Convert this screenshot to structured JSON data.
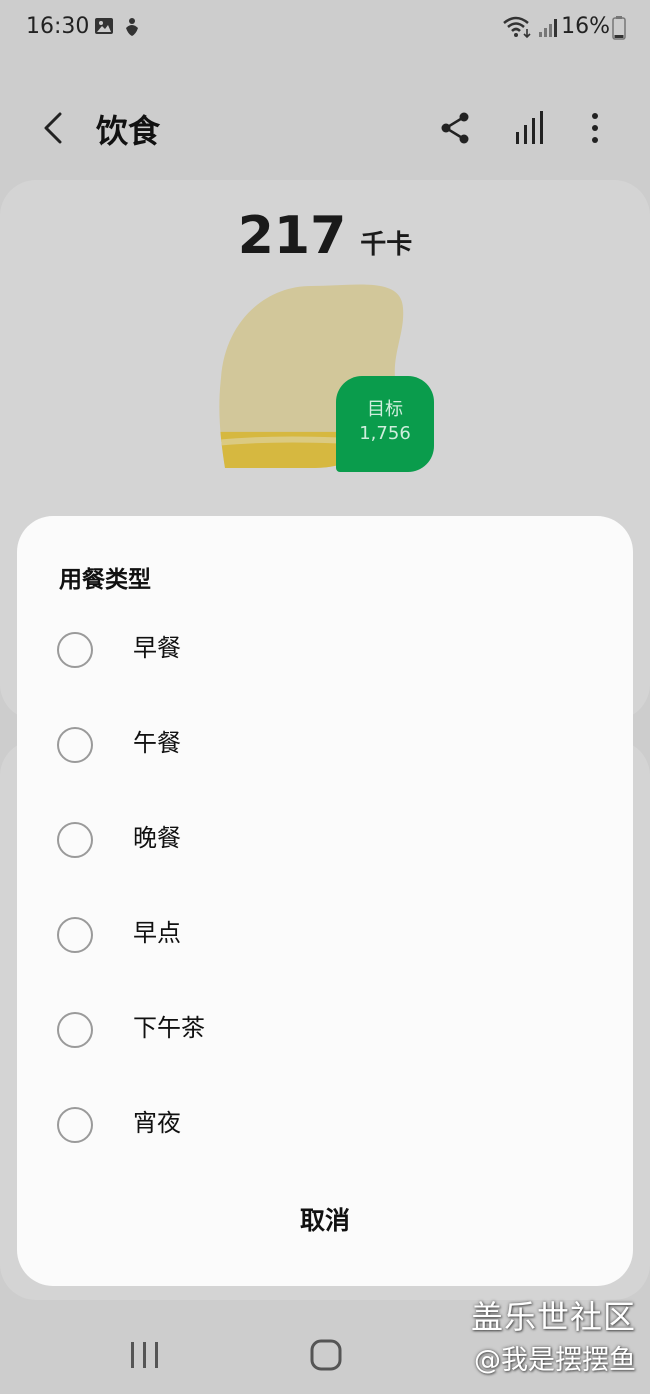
{
  "status_bar": {
    "time": "16:30",
    "battery": "16%"
  },
  "header": {
    "title": "饮食"
  },
  "summary": {
    "calories": "217",
    "unit": "千卡",
    "goal_label": "目标",
    "goal_value": "1,756",
    "consumed_fraction": 0.124
  },
  "dialog": {
    "title": "用餐类型",
    "options": [
      {
        "label": "早餐",
        "selected": false
      },
      {
        "label": "午餐",
        "selected": false
      },
      {
        "label": "晚餐",
        "selected": false
      },
      {
        "label": "早点",
        "selected": false
      },
      {
        "label": "下午茶",
        "selected": false
      },
      {
        "label": "宵夜",
        "selected": false
      }
    ],
    "cancel_label": "取消"
  },
  "watermark": {
    "line1": "盖乐世社区",
    "line2": "@我是摆摆鱼"
  },
  "colors": {
    "accent_green": "#0a9c4c",
    "lemon": "#d2c79a",
    "lemon_fill": "#d6b840"
  },
  "icons": {
    "back": "chevron-left-icon",
    "share": "share-icon",
    "stats": "bar-chart-icon",
    "more": "more-vertical-icon"
  }
}
